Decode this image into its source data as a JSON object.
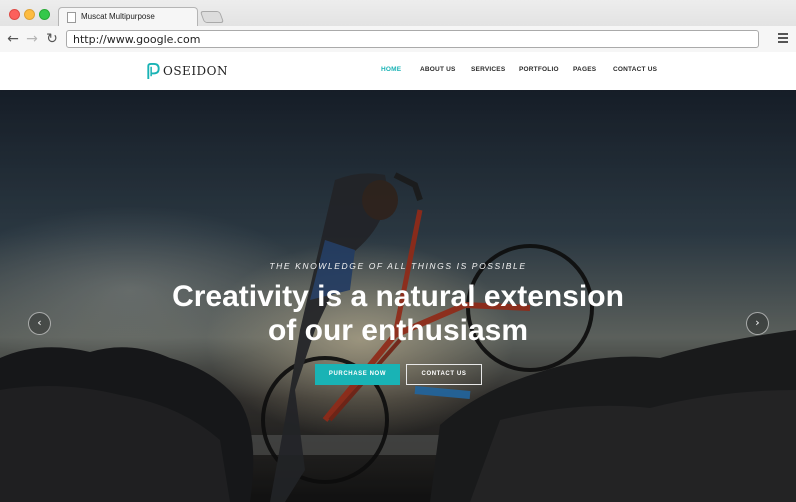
{
  "browser": {
    "tab_title": "Muscat Multipurpose",
    "url": "http://www.google.com"
  },
  "site": {
    "logo_letter": "P",
    "logo_text": "OSEIDON",
    "nav": [
      {
        "label": "HOME",
        "active": true
      },
      {
        "label": "ABOUT US",
        "active": false
      },
      {
        "label": "SERVICES",
        "active": false
      },
      {
        "label": "PORTFOLIO",
        "active": false
      },
      {
        "label": "PAGES",
        "active": false
      },
      {
        "label": "CONTACT US",
        "active": false
      }
    ]
  },
  "hero": {
    "tagline": "THE KNOWLEDGE OF ALL THINGS IS POSSIBLE",
    "headline_line1": "Creativity is a natural extension",
    "headline_line2": "of our enthusiasm",
    "primary_button": "PURCHASE NOW",
    "secondary_button": "CONTACT US",
    "prev_arrow": "‹",
    "next_arrow": "›"
  },
  "colors": {
    "accent": "#19b3b5",
    "nav_text": "#2a2a2a"
  },
  "icons": {
    "back": "arrow-left-icon",
    "forward": "arrow-right-icon",
    "reload": "reload-icon",
    "menu": "hamburger-menu-icon",
    "page": "page-icon"
  }
}
